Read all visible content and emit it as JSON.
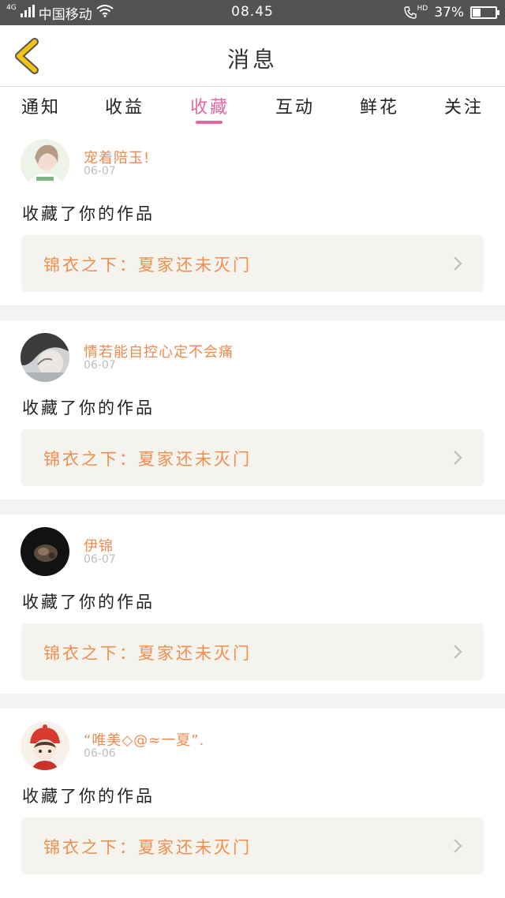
{
  "status_bar": {
    "network": "4G",
    "carrier": "中国移动",
    "time": "08.45",
    "hd": "HD",
    "battery": "37%",
    "battery_level": 0.37
  },
  "header": {
    "title": "消息"
  },
  "tabs": [
    {
      "label": "通知",
      "active": false
    },
    {
      "label": "收益",
      "active": false
    },
    {
      "label": "收藏",
      "active": true
    },
    {
      "label": "互动",
      "active": false
    },
    {
      "label": "鲜花",
      "active": false
    },
    {
      "label": "关注",
      "active": false
    }
  ],
  "messages": [
    {
      "user": "宠着陪玉!",
      "date": "06-07",
      "action": "收藏了你的作品",
      "work_title": "锦衣之下：夏家还未灭门",
      "avatar": "avatar-light-girl"
    },
    {
      "user": "情若能自控心定不会痛",
      "date": "06-07",
      "action": "收藏了你的作品",
      "work_title": "锦衣之下：夏家还未灭门",
      "avatar": "avatar-grey-portrait"
    },
    {
      "user": "伊锦",
      "date": "06-07",
      "action": "收藏了你的作品",
      "work_title": "锦衣之下：夏家还未灭门",
      "avatar": "avatar-dark"
    },
    {
      "user": "“唯美◇@≈一夏”.",
      "date": "06-06",
      "action": "收藏了你的作品",
      "work_title": "锦衣之下：夏家还未灭门",
      "avatar": "avatar-cartoon-red-hat"
    }
  ],
  "colors": {
    "accent_pink": "#e8649e",
    "orange_text": "#ee8a4d",
    "back_arrow": "#f2c40f",
    "status_bar_bg": "#535353"
  }
}
